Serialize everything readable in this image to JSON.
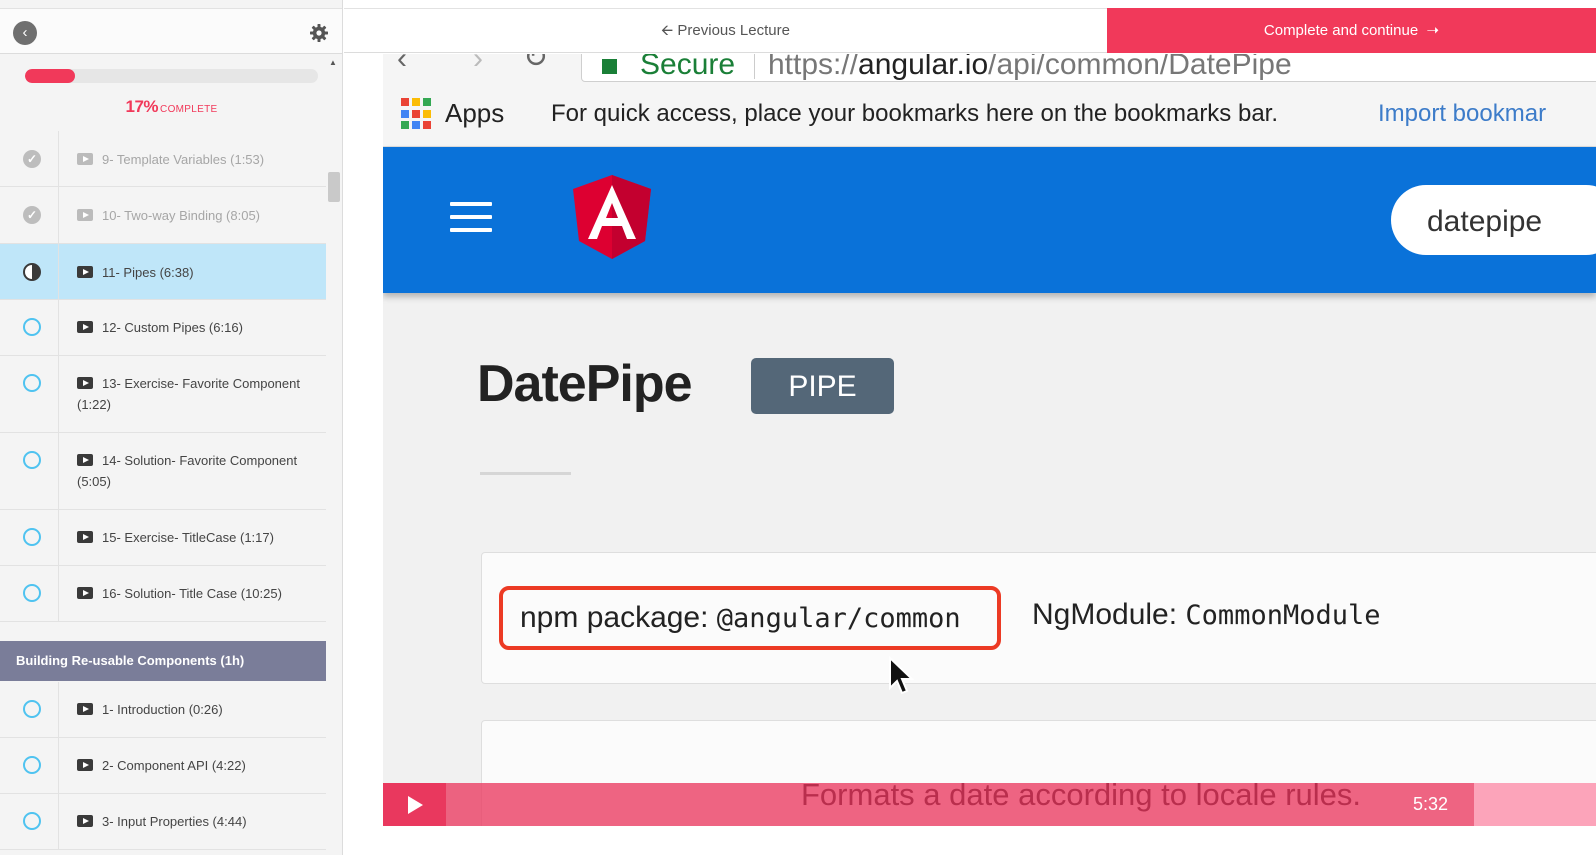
{
  "sidebar": {
    "progress": {
      "percent": 17,
      "percent_text": "17%",
      "label": "COMPLETE"
    },
    "lectures": [
      {
        "label": "9- Template Variables (1:53)",
        "status": "done"
      },
      {
        "label": "10- Two-way Binding (8:05)",
        "status": "done"
      },
      {
        "label": "11- Pipes (6:38)",
        "status": "in-progress"
      },
      {
        "label": "12- Custom Pipes (6:16)",
        "status": "open"
      },
      {
        "label": "13- Exercise- Favorite Component (1:22)",
        "status": "open"
      },
      {
        "label": "14- Solution- Favorite Component (5:05)",
        "status": "open"
      },
      {
        "label": "15- Exercise- TitleCase (1:17)",
        "status": "open"
      },
      {
        "label": "16- Solution- Title Case (10:25)",
        "status": "open"
      }
    ],
    "section": {
      "title": "Building Re-usable Components (1h)",
      "lectures": [
        {
          "label": "1- Introduction (0:26)",
          "status": "open"
        },
        {
          "label": "2- Component API (4:22)",
          "status": "open"
        },
        {
          "label": "3- Input Properties (4:44)",
          "status": "open"
        }
      ]
    }
  },
  "topbar": {
    "prev_label": "Previous Lecture",
    "complete_label": "Complete and continue"
  },
  "video": {
    "browser": {
      "secure_label": "Secure",
      "url_prefix": "https://",
      "url_host": "angular.io",
      "url_path": "/api/common/DatePipe",
      "apps_label": "Apps",
      "bookmarks_message": "For quick access, place your bookmarks here on the bookmarks bar.",
      "import_label": "Import bookmar"
    },
    "site": {
      "search_value": "datepipe",
      "heading": "DatePipe",
      "badge": "PIPE",
      "npm_label": "npm package:",
      "npm_value": "@angular/common",
      "ngmodule_label": "NgModule:",
      "ngmodule_value": "CommonModule",
      "caption": "Formats a date according to locale rules."
    },
    "player": {
      "time": "5:32"
    }
  },
  "colors": {
    "accent": "#f1395a",
    "active_row": "#bfe6f9",
    "section_header": "#7a7d99",
    "angular_blue": "#0a72d9",
    "badge": "#546778",
    "highlight_box": "#ec3a24"
  },
  "icons": [
    "back-icon",
    "gear-icon",
    "check-icon",
    "play-icon",
    "apps-icon",
    "hamburger-icon",
    "angular-logo",
    "mouse-cursor-icon"
  ]
}
